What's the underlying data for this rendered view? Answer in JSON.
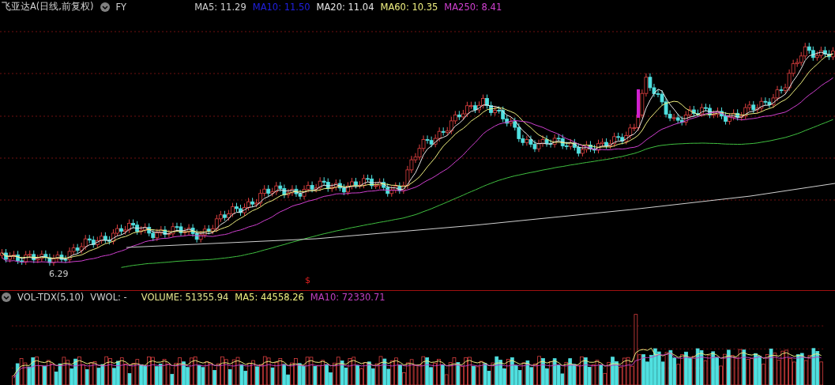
{
  "price_panel": {
    "title": "飞亚达A(日线,前复权)",
    "code": "FY",
    "indicators": [
      {
        "label": "MA5: 11.29",
        "color": "#d0d0d0"
      },
      {
        "label": "MA10: 11.50",
        "color": "#2020e0"
      },
      {
        "label": "MA20: 11.04",
        "color": "#e8e8e8"
      },
      {
        "label": "MA60: 10.35",
        "color": "#f0f080"
      },
      {
        "label": "MA250: 8.41",
        "color": "#d040d0"
      }
    ],
    "low_label": "6.29",
    "marker": "$"
  },
  "volume_panel": {
    "title": "VOL-TDX(5,10)",
    "subtitle": "VWOL: -",
    "indicators": [
      {
        "label": "VOLUME: 51355.94",
        "color": "#e8e890"
      },
      {
        "label": "MA5: 44558.26",
        "color": "#f0f080"
      },
      {
        "label": "MA10: 72330.71",
        "color": "#c040c0"
      }
    ]
  }
}
